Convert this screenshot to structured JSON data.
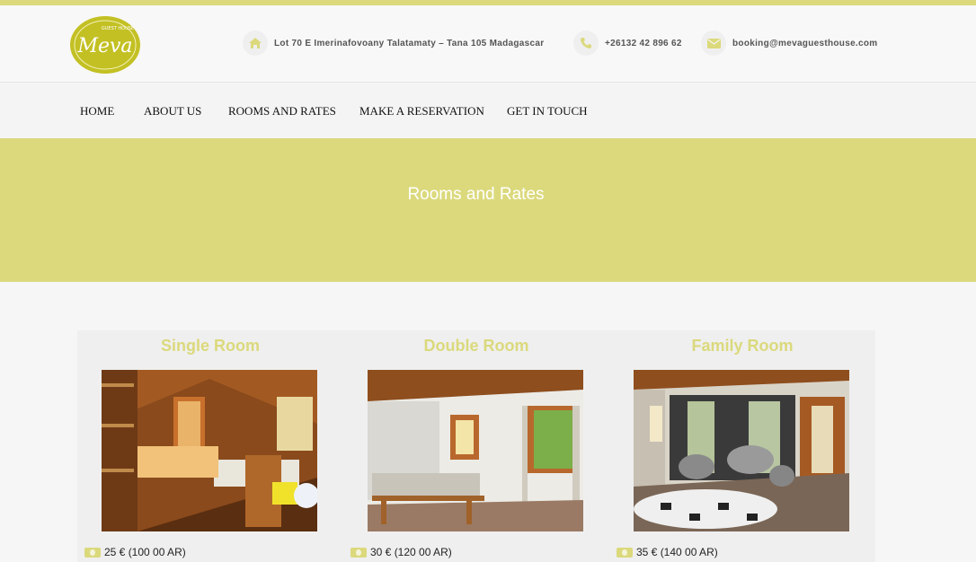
{
  "brand": {
    "logo_text": "Meva",
    "logo_small": "GUEST HOUSE",
    "accent": "#dbd97c"
  },
  "contact": {
    "address": "Lot 70 E Imerinafovoany Talatamaty – Tana 105 Madagascar",
    "phone": "+26132 42 896 62",
    "email": "booking@mevaguesthouse.com"
  },
  "nav": {
    "items": [
      "HOME",
      "ABOUT US",
      "ROOMS AND RATES",
      "MAKE A RESERVATION",
      "GET IN TOUCH"
    ]
  },
  "banner": {
    "title": "Rooms and Rates"
  },
  "rooms": [
    {
      "title": "Single Room",
      "price": "25 € (100 00 AR)"
    },
    {
      "title": "Double Room",
      "price": "30 € (120 00 AR)"
    },
    {
      "title": "Family Room",
      "price": "35 € (140 00 AR)"
    }
  ]
}
